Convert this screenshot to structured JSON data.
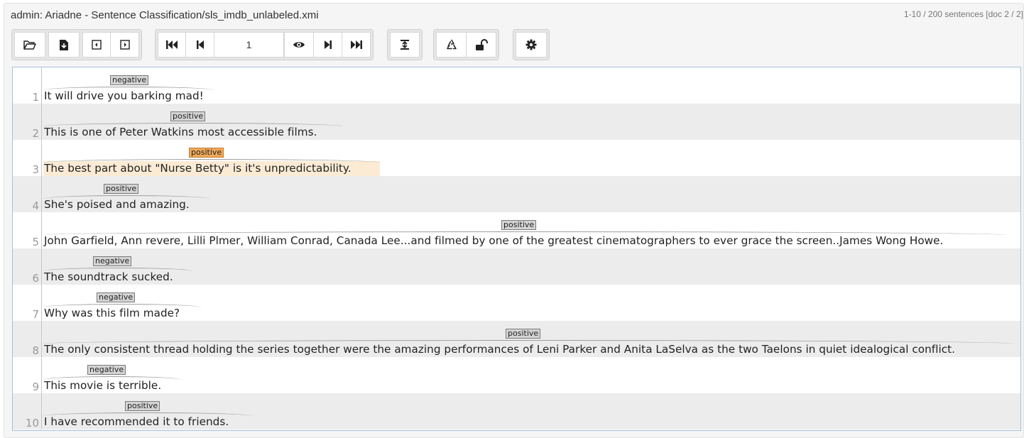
{
  "header": {
    "title": "admin: Ariadne - Sentence Classification/sls_imdb_unlabeled.xmi",
    "status": "1-10 / 200 sentences [doc 2 / 2]"
  },
  "toolbar": {
    "page_number": "1",
    "icons": [
      "folder-open-icon",
      "export-icon",
      "previous-document-icon",
      "next-document-icon",
      "first-page-icon",
      "previous-page-icon",
      "preview-icon",
      "next-page-icon",
      "last-page-icon",
      "recommender-sidebar-icon",
      "reset-icon",
      "unlock-icon",
      "settings-icon"
    ]
  },
  "colors": {
    "selected_tag": "#f0a95a",
    "selected_highlight": "#fbebd5",
    "tag": "#d4d4d4",
    "alt_row": "#ececec"
  },
  "sentences": [
    {
      "line": "1",
      "text": "It will drive you barking mad!",
      "label": "negative",
      "selected": false
    },
    {
      "line": "2",
      "text": "This is one of Peter Watkins most accessible films.",
      "label": "positive",
      "selected": false
    },
    {
      "line": "3",
      "text": "The best part about \"Nurse Betty\" is it's unpredictability.",
      "label": "positive",
      "selected": true
    },
    {
      "line": "4",
      "text": "She's poised and amazing.",
      "label": "positive",
      "selected": false
    },
    {
      "line": "5",
      "text": "John Garfield, Ann revere, Lilli Plmer, William Conrad, Canada Lee...and filmed by one of the greatest cinematographers to ever grace the screen..James Wong Howe.",
      "label": "positive",
      "selected": false
    },
    {
      "line": "6",
      "text": "The soundtrack sucked.",
      "label": "negative",
      "selected": false
    },
    {
      "line": "7",
      "text": "Why was this film made?",
      "label": "negative",
      "selected": false
    },
    {
      "line": "8",
      "text": "The only consistent thread holding the series together were the amazing performances of Leni Parker and Anita LaSelva as the two Taelons in quiet idealogical conflict.",
      "label": "positive",
      "selected": false
    },
    {
      "line": "9",
      "text": "This movie is terrible.",
      "label": "negative",
      "selected": false
    },
    {
      "line": "10",
      "text": "I have recommended it to friends.",
      "label": "positive",
      "selected": false
    }
  ]
}
